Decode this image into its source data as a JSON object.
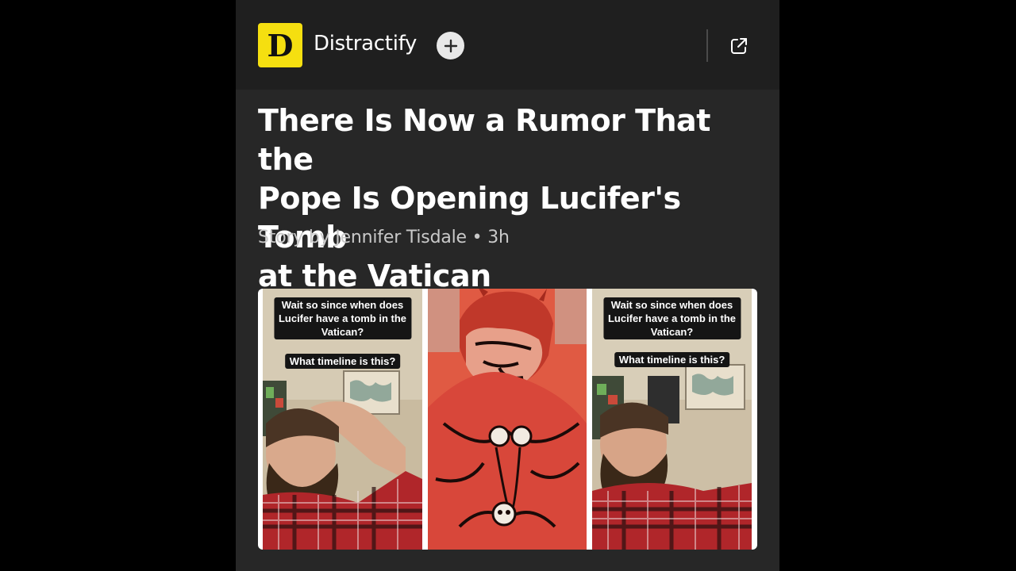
{
  "publisher": {
    "logo_letter": "D",
    "name": "Distractify",
    "logo_color": "#f5df10"
  },
  "actions": {
    "follow_icon": "plus-icon",
    "open_icon": "external-link-icon"
  },
  "article": {
    "headline_line1": "There Is Now a Rumor That the",
    "headline_line2": "Pope Is Opening Lucifer's Tomb",
    "headline_line3": "at the Vatican",
    "byline": "Story by Jennifer Tisdale • 3h"
  },
  "image": {
    "left_panel": {
      "caption1_line1": "Wait so since when does",
      "caption1_line2": "Lucifer have a tomb in the",
      "caption1_line3": "Vatican?",
      "caption2": "What timeline is this?"
    },
    "right_panel": {
      "caption1_line1": "Wait so since when does",
      "caption1_line2": "Lucifer have a tomb in the",
      "caption1_line3": "Vatican?",
      "caption2": "What timeline is this?"
    },
    "middle_color": "#e05a43"
  }
}
